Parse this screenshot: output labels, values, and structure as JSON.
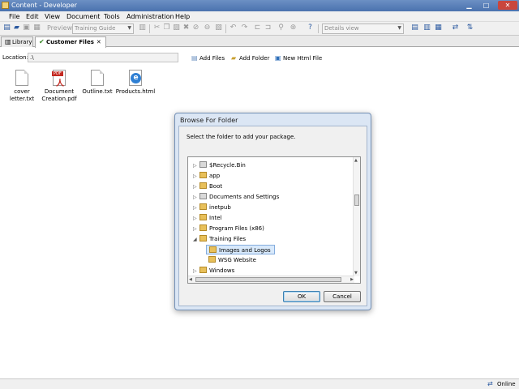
{
  "window": {
    "title": "Content - Developer"
  },
  "menu": [
    "File",
    "Edit",
    "View",
    "Document",
    "Tools",
    "Administration",
    "Help"
  ],
  "toolbar": {
    "preview_label": "Preview",
    "guide_combo": "Training Guide",
    "view_combo": "Details view"
  },
  "tabs": [
    {
      "label": "Library"
    },
    {
      "label": "Customer Files",
      "close": "✕"
    }
  ],
  "location": {
    "label": "Location:",
    "value": ".\\",
    "actions": [
      "Add Files",
      "Add Folder",
      "New Html File"
    ]
  },
  "files": [
    {
      "name_line1": "cover",
      "name_line2": "letter.txt",
      "icon": "text-file-icon"
    },
    {
      "name_line1": "Document",
      "name_line2": "Creation.pdf",
      "icon": "pdf-file-icon",
      "badge": "PDF"
    },
    {
      "name_line1": "Outline.txt",
      "name_line2": "",
      "icon": "text-file-icon"
    },
    {
      "name_line1": "Products.html",
      "name_line2": "",
      "icon": "html-file-icon",
      "glyph": "e"
    }
  ],
  "dialog": {
    "title": "Browse For Folder",
    "description": "Select the folder to add your package.",
    "tree": [
      {
        "label": "$Recycle.Bin",
        "expander": "▷"
      },
      {
        "label": "app",
        "expander": "▷"
      },
      {
        "label": "Boot",
        "expander": "▷"
      },
      {
        "label": "Documents and Settings",
        "expander": "▷"
      },
      {
        "label": "inetpub",
        "expander": "▷"
      },
      {
        "label": "Intel",
        "expander": "▷"
      },
      {
        "label": "Program Files (x86)",
        "expander": "▷"
      },
      {
        "label": "Training Files",
        "expander": "◢"
      },
      {
        "label": "Images and Logos",
        "expander": ""
      },
      {
        "label": "WSG Website",
        "expander": ""
      },
      {
        "label": "Windows",
        "expander": "▷"
      }
    ],
    "ok_label": "OK",
    "cancel_label": "Cancel"
  },
  "status": {
    "text": "Online"
  }
}
